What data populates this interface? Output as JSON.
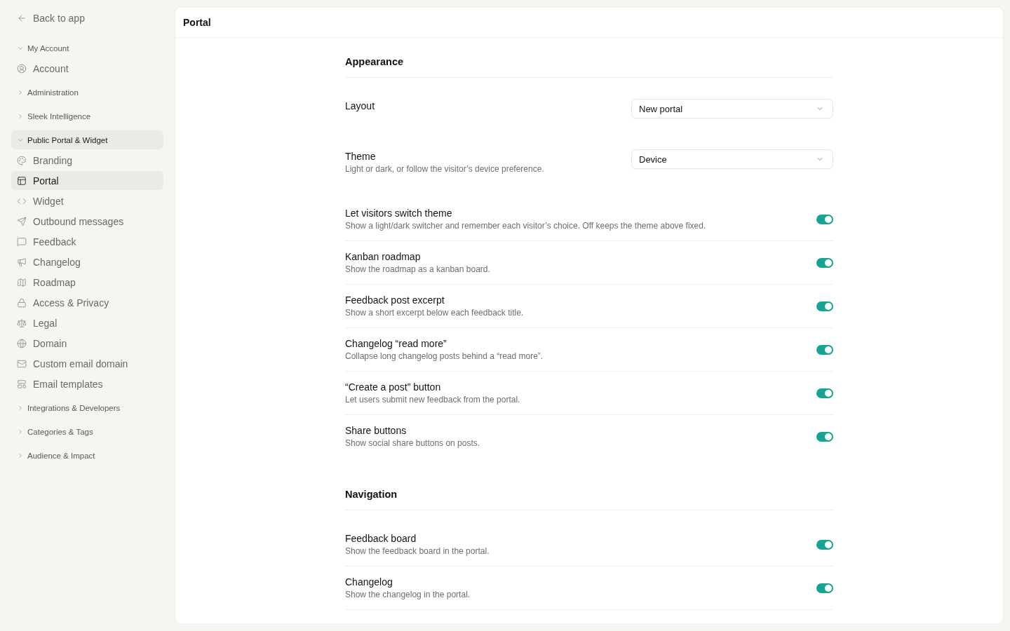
{
  "sidebar": {
    "back_link": "Back to app",
    "groups": [
      {
        "label": "My Account",
        "expanded": true,
        "selected": false,
        "items": [
          {
            "label": "Account",
            "selected": false
          }
        ]
      },
      {
        "label": "Administration",
        "expanded": false,
        "selected": false
      },
      {
        "label": "Sleek Intelligence",
        "expanded": false,
        "selected": false
      },
      {
        "label": "Public Portal & Widget",
        "expanded": true,
        "selected": true,
        "items": [
          {
            "label": "Branding",
            "selected": false
          },
          {
            "label": "Portal",
            "selected": true
          },
          {
            "label": "Widget",
            "selected": false
          },
          {
            "label": "Outbound messages",
            "selected": false
          },
          {
            "label": "Feedback",
            "selected": false
          },
          {
            "label": "Changelog",
            "selected": false
          },
          {
            "label": "Roadmap",
            "selected": false
          },
          {
            "label": "Access & Privacy",
            "selected": false
          },
          {
            "label": "Legal",
            "selected": false
          },
          {
            "label": "Domain",
            "selected": false
          },
          {
            "label": "Custom email domain",
            "selected": false
          },
          {
            "label": "Email templates",
            "selected": false
          }
        ]
      },
      {
        "label": "Integrations & Developers",
        "expanded": false,
        "selected": false
      },
      {
        "label": "Categories & Tags",
        "expanded": false,
        "selected": false
      },
      {
        "label": "Audience & Impact",
        "expanded": false,
        "selected": false
      }
    ]
  },
  "header": {
    "title": "Portal"
  },
  "sections": [
    {
      "title": "Appearance",
      "rows": [
        {
          "kind": "select",
          "label": "Layout",
          "value": "New portal"
        },
        {
          "kind": "select",
          "label": "Theme",
          "description": "Light or dark, or follow the visitor’s device preference.",
          "value": "Device"
        },
        {
          "kind": "toggle",
          "label": "Let visitors switch theme",
          "description": "Show a light/dark switcher and remember each visitor’s choice. Off keeps the theme above fixed.",
          "on": true
        },
        {
          "kind": "toggle",
          "label": "Kanban roadmap",
          "description": "Show the roadmap as a kanban board.",
          "on": true
        },
        {
          "kind": "toggle",
          "label": "Feedback post excerpt",
          "description": "Show a short excerpt below each feedback title.",
          "on": true
        },
        {
          "kind": "toggle",
          "label": "Changelog “read more”",
          "description": "Collapse long changelog posts behind a “read more”.",
          "on": true
        },
        {
          "kind": "toggle",
          "label": "“Create a post” button",
          "description": "Let users submit new feedback from the portal.",
          "on": true
        },
        {
          "kind": "toggle",
          "label": "Share buttons",
          "description": "Show social share buttons on posts.",
          "on": true
        }
      ]
    },
    {
      "title": "Navigation",
      "rows": [
        {
          "kind": "toggle",
          "label": "Feedback board",
          "description": "Show the feedback board in the portal.",
          "on": true
        },
        {
          "kind": "toggle",
          "label": "Changelog",
          "description": "Show the changelog in the portal.",
          "on": true
        }
      ]
    }
  ]
}
